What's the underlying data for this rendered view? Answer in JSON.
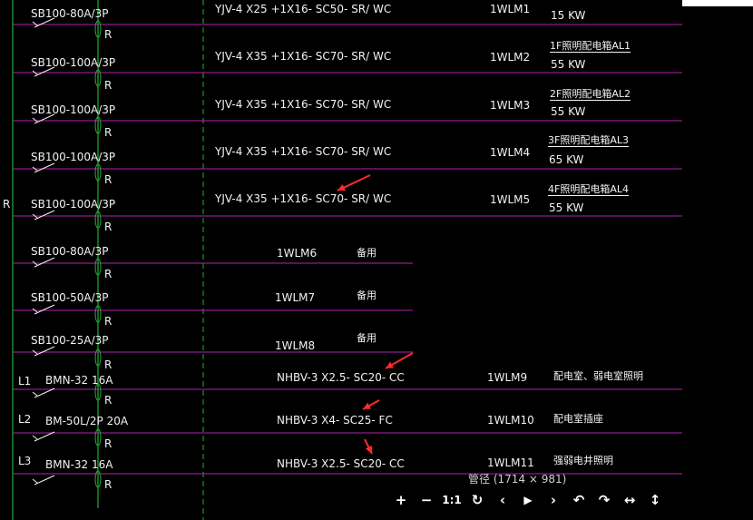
{
  "drawing": {
    "top_strip": {
      "breaker": "SB100-80A/3P",
      "cable": "YJV-4 X25 +1X16- SC50- SR/ WC",
      "circuit": "1WLM1",
      "load": "15 KW"
    },
    "rows": [
      {
        "breaker": "SB100-100A/3P",
        "cable": "YJV-4 X35 +1X16- SC70- SR/ WC",
        "circuit": "1WLM2",
        "dest": "1F照明配电箱AL1",
        "load": "55 KW"
      },
      {
        "breaker": "SB100-100A/3P",
        "cable": "YJV-4 X35 +1X16- SC70- SR/ WC",
        "circuit": "1WLM3",
        "dest": "2F照明配电箱AL2",
        "load": "55 KW"
      },
      {
        "breaker": "SB100-100A/3P",
        "cable": "YJV-4 X35 +1X16- SC70- SR/ WC",
        "circuit": "1WLM4",
        "dest": "3F照明配电箱AL3",
        "load": "65 KW"
      },
      {
        "breaker": "SB100-100A/3P",
        "cable": "YJV-4 X35 +1X16- SC70- SR/ WC",
        "circuit": "1WLM5",
        "dest": "4F照明配电箱AL4",
        "load": "55 KW"
      }
    ],
    "spares": [
      {
        "breaker": "SB100-80A/3P",
        "circuit": "1WLM6",
        "note": "备用"
      },
      {
        "breaker": "SB100-50A/3P",
        "circuit": "1WLM7",
        "note": "备用"
      },
      {
        "breaker": "SB100-25A/3P",
        "circuit": "1WLM8",
        "note": "备用"
      }
    ],
    "branches": [
      {
        "phase": "L1",
        "breaker": "BMN-32 16A",
        "cable": "NHBV-3 X2.5- SC20- CC",
        "circuit": "1WLM9",
        "dest": "配电室、弱电室照明"
      },
      {
        "phase": "L2",
        "breaker": "BM-50L/2P 20A",
        "cable": "NHBV-3 X4- SC25- FC",
        "circuit": "1WLM10",
        "dest": "配电室插座"
      },
      {
        "phase": "L3",
        "breaker": "BMN-32 16A",
        "cable": "NHBV-3 X2.5- SC20- CC",
        "circuit": "1WLM11",
        "dest": "强弱电井照明"
      }
    ],
    "r_label": "R",
    "left_r_label": "R"
  },
  "viewer": {
    "size_info": "管径 (1714 × 981)",
    "toolbar": {
      "zoom_in": "+",
      "zoom_out": "−",
      "actual_size": "1:1",
      "rotate": "↻",
      "prev": "‹",
      "play": "▶",
      "next": "›",
      "undo": "↶",
      "redo": "↷",
      "flip_h": "↔",
      "flip_v": "↕"
    }
  },
  "colors": {
    "line": "#b51fb5",
    "bus": "#20b030",
    "text": "#f2f2f2",
    "arrow": "#ff2a2a",
    "background": "#000000"
  }
}
